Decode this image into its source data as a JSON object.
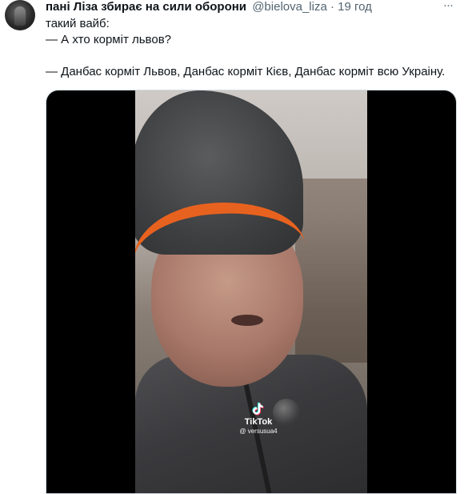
{
  "tweet": {
    "display_name": "пані Ліза збирає на сили оборони",
    "handle": "@bielova_liza",
    "separator": "·",
    "timestamp": "19 год",
    "lines": [
      "такий вайб:",
      "— А хто корміт львов?",
      "",
      "— Данбас корміт Львов, Данбас корміт Кієв, Данбас корміт всю Украіну."
    ]
  },
  "media": {
    "watermark_brand": "TikTok",
    "watermark_user": "@ versusua4"
  },
  "icons": {
    "more": "more-horizontal-icon",
    "watermark": "tiktok-logo-icon"
  },
  "colors": {
    "text_primary": "#0f1419",
    "text_secondary": "#536471",
    "hat_band": "#e8621f"
  }
}
